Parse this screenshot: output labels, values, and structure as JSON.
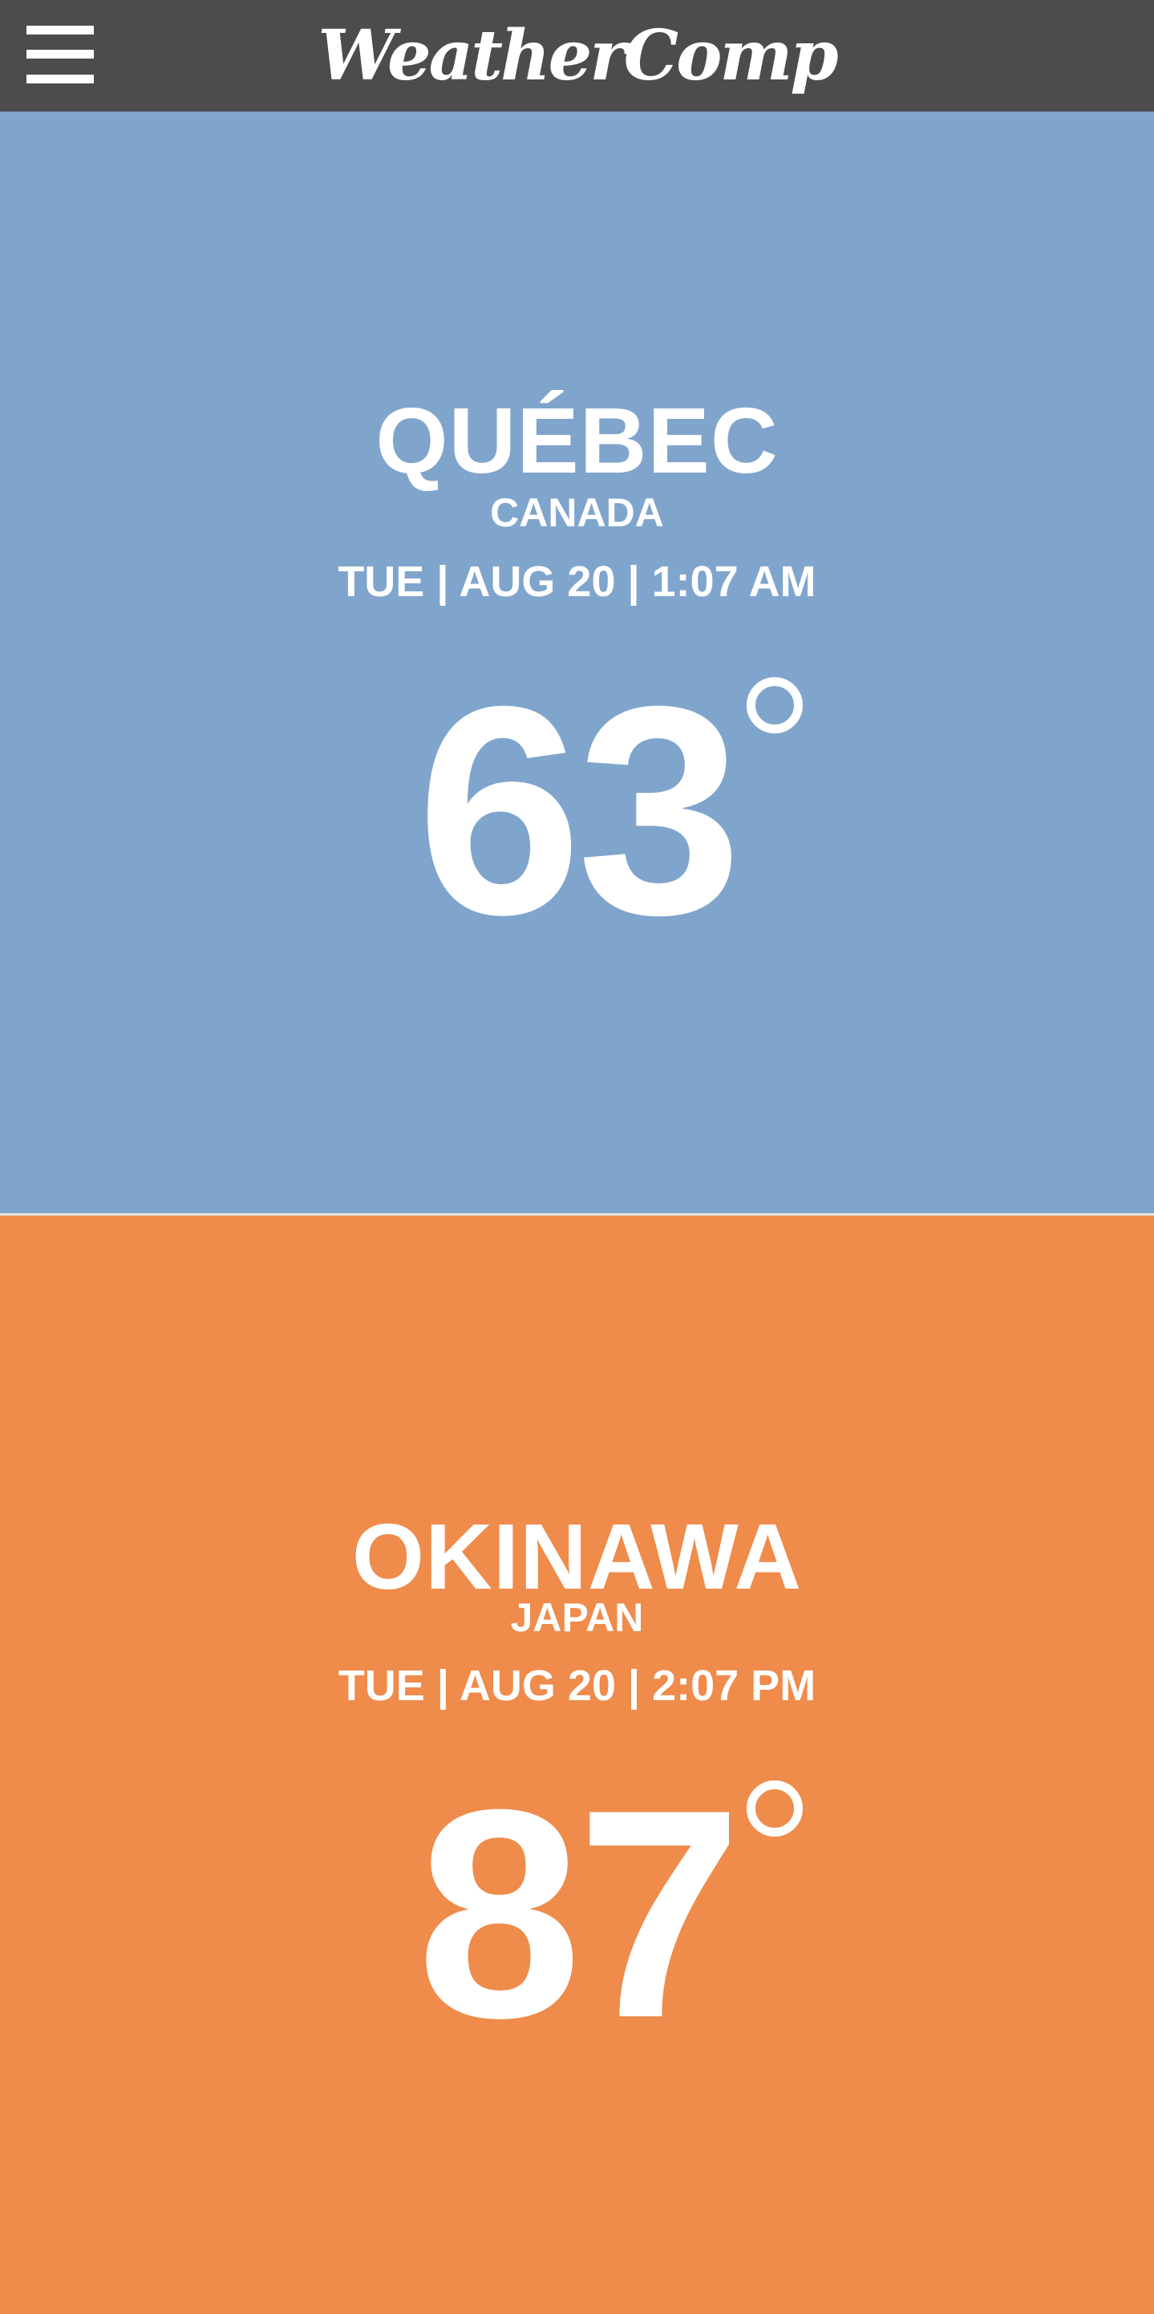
{
  "app": {
    "title": "WeatherComp"
  },
  "cities": [
    {
      "city": "QUÉBEC",
      "country": "CANADA",
      "datetime": "TUE | AUG 20 | 1:07 AM",
      "temperature": "63",
      "background_color": "#80a5cc"
    },
    {
      "city": "OKINAWA",
      "country": "JAPAN",
      "datetime": "TUE | AUG 20 | 2:07 PM",
      "temperature": "87",
      "background_color": "#ef8b4b"
    }
  ],
  "colors": {
    "header": "#4c4c4c",
    "text": "#ffffff"
  },
  "icons": {
    "menu": "hamburger-menu-icon",
    "degree": "degree-symbol-icon"
  }
}
